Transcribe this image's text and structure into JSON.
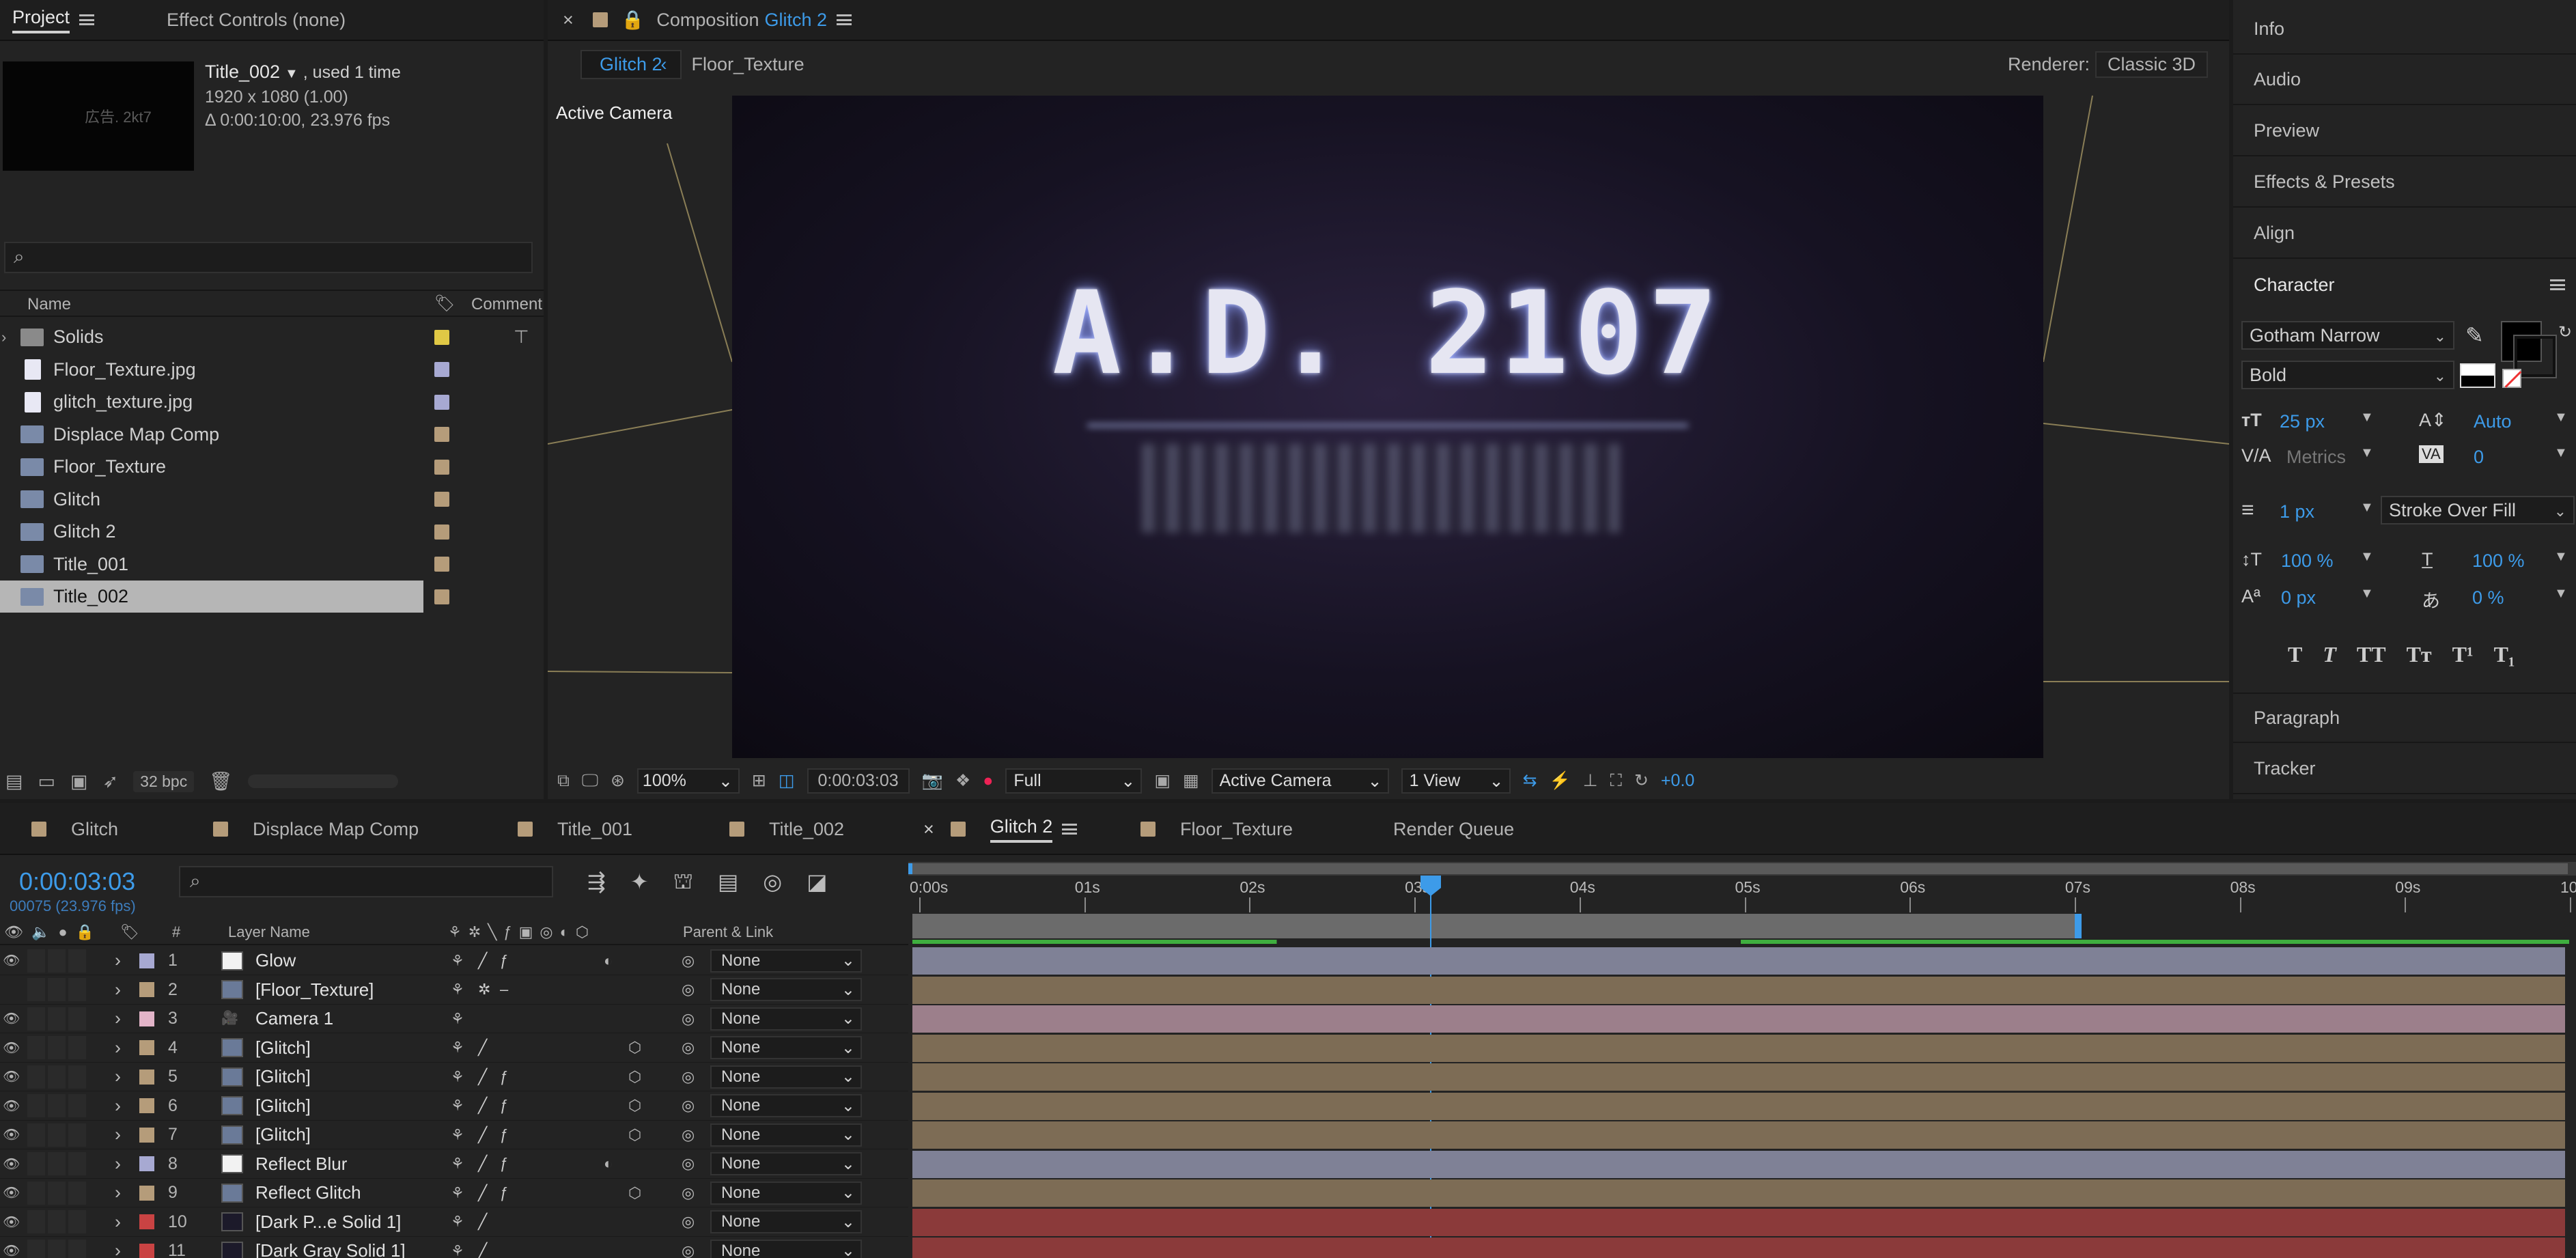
{
  "project_panel": {
    "tab_project": "Project",
    "tab_effect_controls": "Effect Controls (none)",
    "item_name": "Title_002",
    "used": ", used 1 time",
    "dimensions": "1920 x 1080 (1.00)",
    "duration": "Δ 0:00:10:00, 23.976 fps",
    "thumb_text": "広告. 2kt7",
    "search_placeholder": "",
    "col_name": "Name",
    "col_comment": "Comment",
    "items": [
      {
        "label": "Solids",
        "type": "folder",
        "color": "#e0c845"
      },
      {
        "label": "Floor_Texture.jpg",
        "type": "file",
        "color": "#a7a9d2"
      },
      {
        "label": "glitch_texture.jpg",
        "type": "file",
        "color": "#a7a9d2"
      },
      {
        "label": "Displace Map Comp",
        "type": "comp",
        "color": "#b59c7a"
      },
      {
        "label": "Floor_Texture",
        "type": "comp",
        "color": "#b59c7a"
      },
      {
        "label": "Glitch",
        "type": "comp",
        "color": "#b59c7a"
      },
      {
        "label": "Glitch 2",
        "type": "comp",
        "color": "#b59c7a"
      },
      {
        "label": "Title_001",
        "type": "comp",
        "color": "#b59c7a"
      },
      {
        "label": "Title_002",
        "type": "comp",
        "color": "#b59c7a",
        "selected": true
      }
    ],
    "bpc": "32 bpc"
  },
  "composition": {
    "title_prefix": "Composition",
    "title_name": "Glitch 2",
    "crumb_active": "Glitch 2",
    "crumb_next": "Floor_Texture",
    "renderer_label": "Renderer:",
    "renderer_value": "Classic 3D",
    "view_label": "Active Camera",
    "canvas_text": "A.D. 2107",
    "zoom": "100%",
    "timecode": "0:00:03:03",
    "resolution": "Full",
    "camera": "Active Camera",
    "views": "1 View",
    "exposure": "+0.0"
  },
  "right_panels": {
    "info": "Info",
    "audio": "Audio",
    "preview": "Preview",
    "effects": "Effects & Presets",
    "align": "Align",
    "character": "Character",
    "paragraph": "Paragraph",
    "tracker": "Tracker"
  },
  "character": {
    "font": "Gotham Narrow",
    "style": "Bold",
    "size": "25 px",
    "leading": "Auto",
    "kerning": "Metrics",
    "tracking": "0",
    "stroke_width": "1 px",
    "stroke_mode": "Stroke Over Fill",
    "vscale": "100 %",
    "hscale": "100 %",
    "baseline": "0 px",
    "tsume": "0 %",
    "styles": [
      "T",
      "T",
      "TT",
      "Tт",
      "T¹",
      "T₁"
    ]
  },
  "timeline": {
    "tabs": [
      "Glitch",
      "Displace Map Comp",
      "Title_001",
      "Title_002",
      "Glitch 2",
      "Floor_Texture",
      "Render Queue"
    ],
    "active_tab": "Glitch 2",
    "timecode": "0:00:03:03",
    "frames": "00075 (23.976 fps)",
    "col_hash": "#",
    "col_layer": "Layer Name",
    "col_parent": "Parent & Link",
    "ruler": [
      "0:00s",
      "01s",
      "02s",
      "03s",
      "04s",
      "05s",
      "06s",
      "07s",
      "08s",
      "09s",
      "10"
    ],
    "layers": [
      {
        "num": "1",
        "name": "Glow",
        "label": "#a7a9d2",
        "bar": "#7f8196",
        "parent": "None"
      },
      {
        "num": "2",
        "name": "[Floor_Texture]",
        "label": "#b59c7a",
        "bar": "#7d6c55",
        "parent": "None"
      },
      {
        "num": "3",
        "name": "Camera 1",
        "label": "#e2b4c8",
        "bar": "#9c7f8b",
        "parent": "None"
      },
      {
        "num": "4",
        "name": "[Glitch]",
        "label": "#b59c7a",
        "bar": "#7d6c55",
        "parent": "None"
      },
      {
        "num": "5",
        "name": "[Glitch]",
        "label": "#b59c7a",
        "bar": "#7d6c55",
        "parent": "None"
      },
      {
        "num": "6",
        "name": "[Glitch]",
        "label": "#b59c7a",
        "bar": "#7d6c55",
        "parent": "None"
      },
      {
        "num": "7",
        "name": "[Glitch]",
        "label": "#b59c7a",
        "bar": "#7d6c55",
        "parent": "None"
      },
      {
        "num": "8",
        "name": "Reflect Blur",
        "label": "#a7a9d2",
        "bar": "#7f8196",
        "parent": "None"
      },
      {
        "num": "9",
        "name": "Reflect Glitch",
        "label": "#b59c7a",
        "bar": "#7d6c55",
        "parent": "None"
      },
      {
        "num": "10",
        "name": "[Dark P...e Solid 1]",
        "label": "#c94343",
        "bar": "#8b3a3a",
        "parent": "None"
      },
      {
        "num": "11",
        "name": "[Dark Gray Solid 1]",
        "label": "#c94343",
        "bar": "#8b3a3a",
        "parent": "None"
      }
    ]
  },
  "colors": {
    "accent": "#3d9be9",
    "panel": "#232323",
    "bg": "#1b1b1b"
  }
}
